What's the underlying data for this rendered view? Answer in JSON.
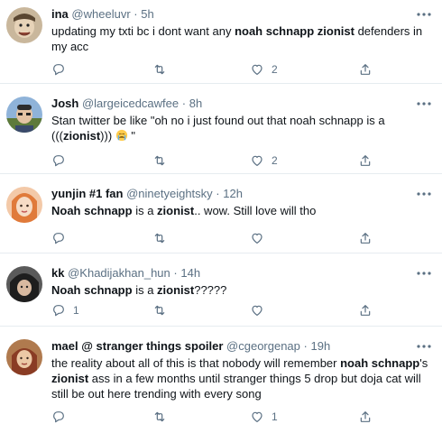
{
  "tweets": [
    {
      "name": "ina",
      "handle": "@wheeluvr",
      "separator": "·",
      "time": "5h",
      "text_segments": [
        {
          "text": "updating my txti bc i dont want any ",
          "bold": false
        },
        {
          "text": "noah schnapp zionist",
          "bold": true
        },
        {
          "text": " defenders in my acc",
          "bold": false
        }
      ],
      "reply_count": "",
      "retweet_count": "",
      "like_count": "2",
      "avatar_icon": "avatar-ina"
    },
    {
      "name": "Josh",
      "handle": "@largeicedcawfee",
      "separator": "·",
      "time": "8h",
      "text_segments": [
        {
          "text": "Stan twitter be like \"oh no i just found out that ",
          "bold": false
        },
        {
          "text": "noah schnapp",
          "bold": false
        },
        {
          "text": " is a (((",
          "bold": false
        },
        {
          "text": "zionist",
          "bold": true
        },
        {
          "text": "))) ",
          "bold": false
        },
        {
          "emoji": "crying-face"
        },
        {
          "text": " \"",
          "bold": false
        }
      ],
      "reply_count": "",
      "retweet_count": "",
      "like_count": "2",
      "avatar_icon": "avatar-josh"
    },
    {
      "name": "yunjin #1 fan",
      "handle": "@ninetyeightsky",
      "separator": "·",
      "time": "12h",
      "text_segments": [
        {
          "text": "Noah schnapp",
          "bold": true
        },
        {
          "text": " is a ",
          "bold": false
        },
        {
          "text": "zionist",
          "bold": true
        },
        {
          "text": ".. wow. Still love will tho",
          "bold": false
        }
      ],
      "reply_count": "",
      "retweet_count": "",
      "like_count": "",
      "avatar_icon": "avatar-yunjin"
    },
    {
      "name": "kk",
      "handle": "@Khadijakhan_hun",
      "separator": "·",
      "time": "14h",
      "text_segments": [
        {
          "text": "Noah schnapp",
          "bold": true
        },
        {
          "text": " is a ",
          "bold": false
        },
        {
          "text": "zionist",
          "bold": true
        },
        {
          "text": "?????",
          "bold": false
        }
      ],
      "reply_count": "1",
      "retweet_count": "",
      "like_count": "",
      "avatar_icon": "avatar-kk"
    },
    {
      "name": "mael @ stranger things spoiler",
      "handle": "@cgeorgenap",
      "separator": "·",
      "time": "19h",
      "text_segments": [
        {
          "text": "the reality about all of this is that nobody will remember ",
          "bold": false
        },
        {
          "text": "noah schnapp",
          "bold": true
        },
        {
          "text": "'s ",
          "bold": false
        },
        {
          "text": "zionist",
          "bold": true
        },
        {
          "text": " ass in a few months until stranger things 5 drop but doja cat will still be out here trending with every song",
          "bold": false
        }
      ],
      "reply_count": "",
      "retweet_count": "",
      "like_count": "1",
      "avatar_icon": "avatar-mael"
    }
  ],
  "colors": {
    "text": "#0f1419",
    "secondary": "#5b7083",
    "divider": "#e6ecf0"
  }
}
